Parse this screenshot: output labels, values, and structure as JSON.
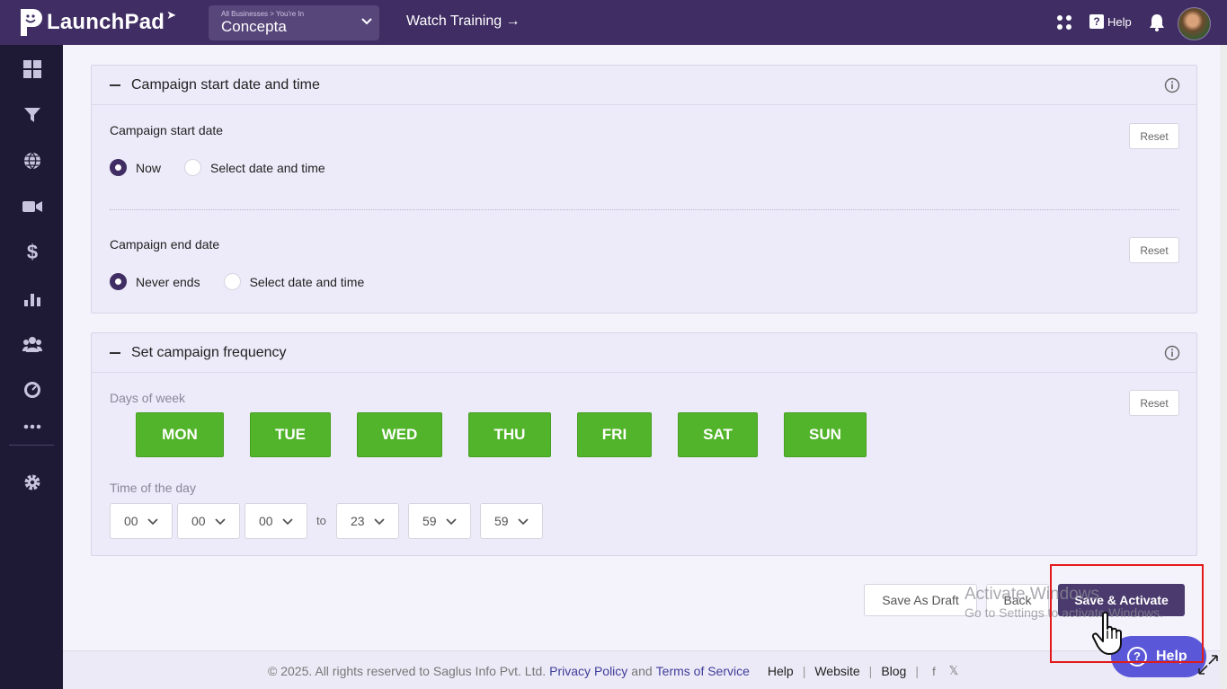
{
  "topbar": {
    "brand": "LaunchPad",
    "business_caption": "All Businesses > You're In",
    "business_name": "Concepta",
    "watch_training": "Watch Training →",
    "help_label": "Help"
  },
  "sidebar": {
    "items": [
      "dashboard-icon",
      "funnel-icon",
      "globe-icon",
      "video-icon",
      "dollar-icon",
      "chart-icon",
      "users-icon",
      "gauge-icon",
      "more-icon",
      "gear-icon"
    ]
  },
  "start_panel": {
    "title": "Campaign start date and time",
    "start_label": "Campaign start date",
    "start_options": [
      "Now",
      "Select date and time"
    ],
    "start_selected": "Now",
    "end_label": "Campaign end date",
    "end_options": [
      "Never ends",
      "Select date and time"
    ],
    "end_selected": "Never ends",
    "reset": "Reset"
  },
  "frequency_panel": {
    "title": "Set campaign frequency",
    "days_label": "Days of week",
    "days": [
      "MON",
      "TUE",
      "WED",
      "THU",
      "FRI",
      "SAT",
      "SUN"
    ],
    "time_label": "Time of the day",
    "from_time": [
      "00",
      "00",
      "00"
    ],
    "to_label": "to",
    "to_time": [
      "23",
      "59",
      "59"
    ],
    "reset": "Reset"
  },
  "actions": {
    "save_draft": "Save As Draft",
    "back": "Back",
    "save_activate": "Save & Activate"
  },
  "watermark": {
    "line1": "Activate Windows",
    "line2": "Go to Settings to activate Windows."
  },
  "help_widget": "Help",
  "footer": {
    "copyright": "©  2025. All rights reserved to Saglus Info Pvt. Ltd.",
    "privacy": "Privacy Policy",
    "and": "and",
    "terms": "Terms of Service",
    "links": [
      "Help",
      "Website",
      "Blog"
    ],
    "social": [
      "f",
      "𝕏"
    ]
  },
  "colors": {
    "topbar": "#3f2d63",
    "sidebar": "#1e1a35",
    "day_active": "#52b42a",
    "primary": "#4a3a6e",
    "highlight": "#e21a1a"
  }
}
